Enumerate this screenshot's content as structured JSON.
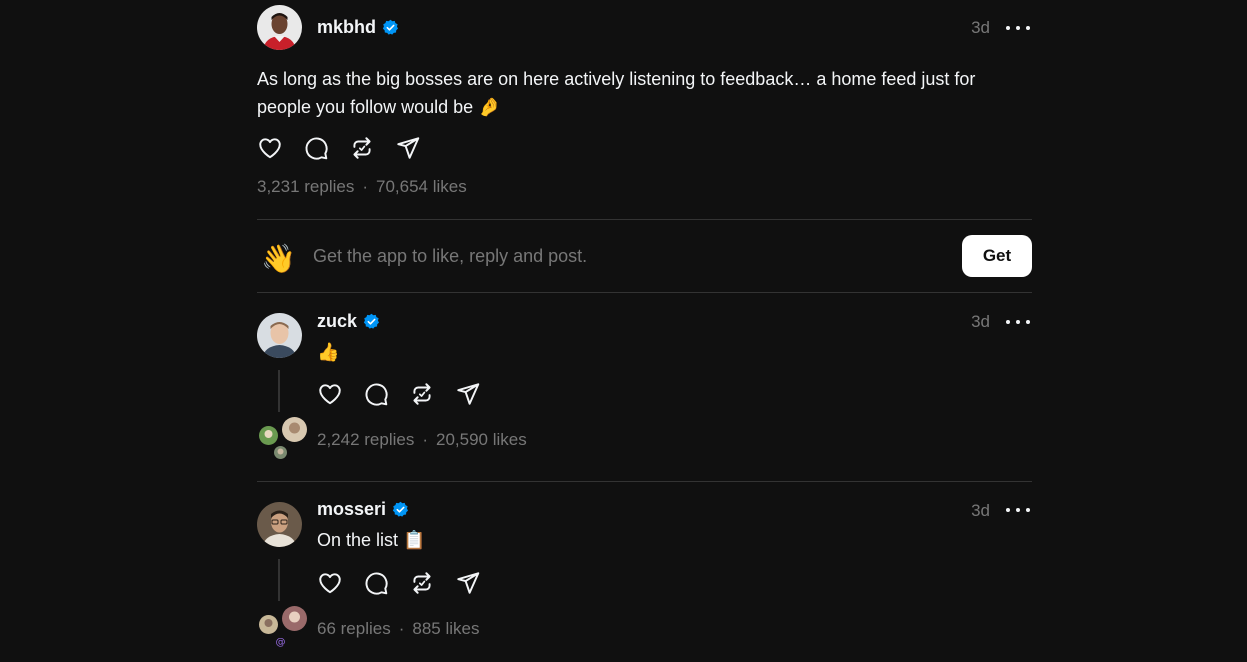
{
  "posts": [
    {
      "username": "mkbhd",
      "time": "3d",
      "text": "As long as the big bosses are on here actively listening to feedback… a home feed just for people you follow would be 🤌",
      "replies": "3,231 replies",
      "likes": "70,654 likes",
      "verified_color": "#0095f6"
    },
    {
      "username": "zuck",
      "time": "3d",
      "text": "👍",
      "replies": "2,242 replies",
      "likes": "20,590 likes",
      "verified_color": "#0095f6"
    },
    {
      "username": "mosseri",
      "time": "3d",
      "text": "On the list 📋",
      "replies": "66 replies",
      "likes": "885 likes",
      "verified_color": "#0095f6"
    }
  ],
  "cta": {
    "icon": "👋",
    "text": "Get the app to like, reply and post.",
    "button_label": "Get"
  },
  "separator": "·",
  "icons": {
    "like": "heart-icon",
    "reply": "comment-icon",
    "repost": "repost-icon",
    "share": "send-icon",
    "more": "more-icon",
    "verified": "verified-badge-icon"
  },
  "colors": {
    "background": "#101010",
    "text_primary": "#f3f5f7",
    "text_secondary": "#777777",
    "verified": "#0095f6",
    "button_bg": "#ffffff"
  }
}
